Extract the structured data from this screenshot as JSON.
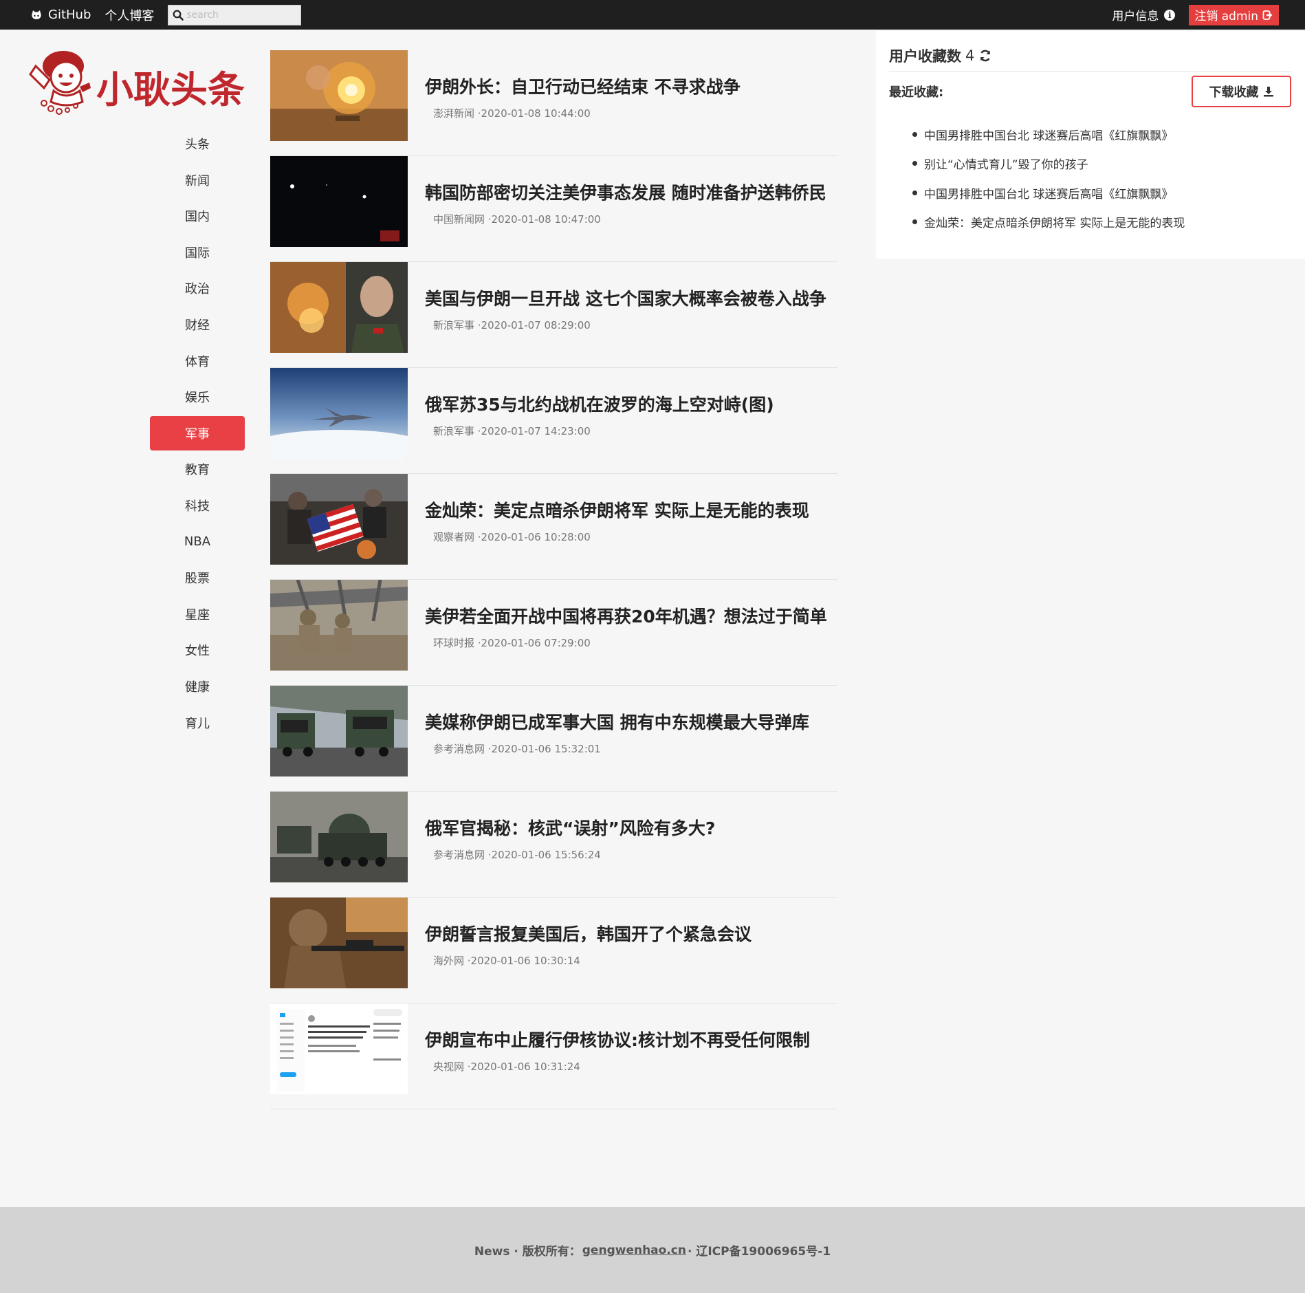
{
  "topbar": {
    "github_label": "GitHub",
    "blog_label": "个人博客",
    "search_placeholder": "search",
    "user_info_label": "用户信息",
    "logout_label": "注销 admin"
  },
  "logo": {
    "text": "小耿头条"
  },
  "nav": {
    "items": [
      {
        "label": "头条"
      },
      {
        "label": "新闻"
      },
      {
        "label": "国内"
      },
      {
        "label": "国际"
      },
      {
        "label": "政治"
      },
      {
        "label": "财经"
      },
      {
        "label": "体育"
      },
      {
        "label": "娱乐"
      },
      {
        "label": "军事",
        "active": true
      },
      {
        "label": "教育"
      },
      {
        "label": "科技"
      },
      {
        "label": "NBA"
      },
      {
        "label": "股票"
      },
      {
        "label": "星座"
      },
      {
        "label": "女性"
      },
      {
        "label": "健康"
      },
      {
        "label": "育儿"
      }
    ]
  },
  "news": {
    "items": [
      {
        "title": "伊朗外长：自卫行动已经结束 不寻求战争",
        "meta": "澎湃新闻 ·2020-01-08 10:44:00",
        "image": "explosion"
      },
      {
        "title": "韩国防部密切关注美伊事态发展 随时准备护送韩侨民",
        "meta": "中国新闻网 ·2020-01-08 10:47:00",
        "image": "night-sky"
      },
      {
        "title": "美国与伊朗一旦开战 这七个国家大概率会被卷入战争",
        "meta": "新浪军事 ·2020-01-07 08:29:00",
        "image": "fire-and-general"
      },
      {
        "title": "俄军苏35与北约战机在波罗的海上空对峙(图)",
        "meta": "新浪军事 ·2020-01-07 14:23:00",
        "image": "fighter-jet"
      },
      {
        "title": "金灿荣：美定点暗杀伊朗将军 实际上是无能的表现",
        "meta": "观察者网 ·2020-01-06 10:28:00",
        "image": "flag-protest"
      },
      {
        "title": "美伊若全面开战中国将再获20年机遇？想法过于简单",
        "meta": "环球时报 ·2020-01-06 07:29:00",
        "image": "soldiers-bridge"
      },
      {
        "title": "美媒称伊朗已成军事大国 拥有中东规模最大导弹库",
        "meta": "参考消息网 ·2020-01-06 15:32:01",
        "image": "missile-trucks"
      },
      {
        "title": "俄军官揭秘：核武“误射”风险有多大?",
        "meta": "参考消息网 ·2020-01-06 15:56:24",
        "image": "missile-convoy"
      },
      {
        "title": "伊朗誓言报复美国后，韩国开了个紧急会议",
        "meta": "海外网 ·2020-01-06 10:30:14",
        "image": "sniper"
      },
      {
        "title": "伊朗宣布中止履行伊核协议:核计划不再受任何限制",
        "meta": "央视网 ·2020-01-06 10:31:24",
        "image": "twitter-screenshot"
      }
    ]
  },
  "panel": {
    "title": "用户收藏数",
    "count": "4",
    "recent_label": "最近收藏:",
    "download_label": "下载收藏",
    "favorites": [
      "中国男排胜中国台北 球迷赛后高唱《红旗飘飘》",
      "别让“心情式育儿”毁了你的孩子",
      "中国男排胜中国台北 球迷赛后高唱《红旗飘飘》",
      "金灿荣：美定点暗杀伊朗将军 实际上是无能的表现"
    ]
  },
  "footer": {
    "prefix": "News · 版权所有：",
    "link": "gengwenhao.cn",
    "suffix": " · 辽ICP备19006965号-1"
  },
  "colors": {
    "accent": "#e84045",
    "topbar_bg": "#1f1f1f",
    "logo_red": "#c0272d"
  }
}
